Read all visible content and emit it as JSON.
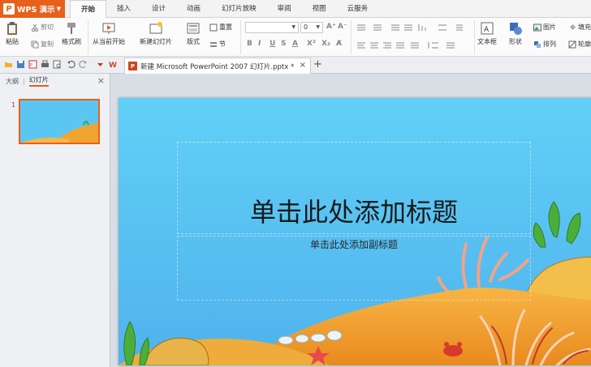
{
  "app": {
    "name": "WPS 演示"
  },
  "menu": {
    "tabs": [
      "开始",
      "插入",
      "设计",
      "动画",
      "幻灯片放映",
      "审阅",
      "视图",
      "云服务"
    ],
    "active": 0
  },
  "ribbon": {
    "paste": "粘贴",
    "cut": "剪切",
    "copy": "复制",
    "format_painter": "格式刷",
    "from_current": "从当前开始",
    "new_slide": "新建幻灯片",
    "layout": "版式",
    "reset": "重置",
    "section": "节",
    "font_name": "",
    "font_size": "0",
    "text_box": "文本框",
    "shape": "形状",
    "picture": "图片",
    "fill": "填充",
    "arrange": "排列",
    "outline": "轮廓"
  },
  "document": {
    "tab_title": "新建 Microsoft PowerPoint 2007 幻灯片.pptx *"
  },
  "left_panel": {
    "outline_tab": "大纲",
    "slides_tab": "幻灯片",
    "slide_number": "1"
  },
  "slide": {
    "title": "单击此处添加标题",
    "subtitle": "单击此处添加副标题"
  },
  "colors": {
    "accent": "#e8601c",
    "sky_top": "#4fc0f0",
    "sky_bottom": "#5bb9ee",
    "sand": "#f0a531"
  }
}
